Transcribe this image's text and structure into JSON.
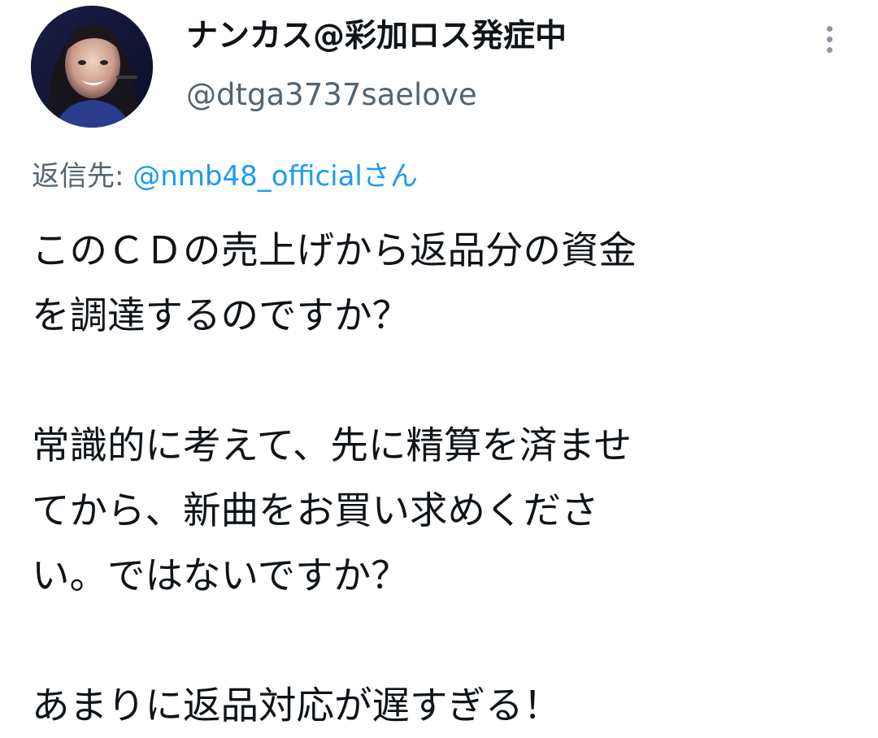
{
  "author": {
    "display_name": "ナンカス@彩加ロス発症中",
    "handle": "@dtga3737saelove",
    "avatar_icon": "profile-photo-avatar"
  },
  "menu": {
    "icon": "more-vertical-icon"
  },
  "reply": {
    "prefix": "返信先: ",
    "user": "@nmb48_officialさん"
  },
  "tweet": {
    "text": "このＣＤの売上げから返品分の資金\nを調達するのですか？\n\n常識的に考えて、先に精算を済ませ\nてから、新曲をお買い求めくださ\nい。ではないですか？\n\nあまりに返品対応が遅すぎる！"
  },
  "colors": {
    "text": "#0f1419",
    "secondary": "#536471",
    "link": "#1d9bf0"
  }
}
